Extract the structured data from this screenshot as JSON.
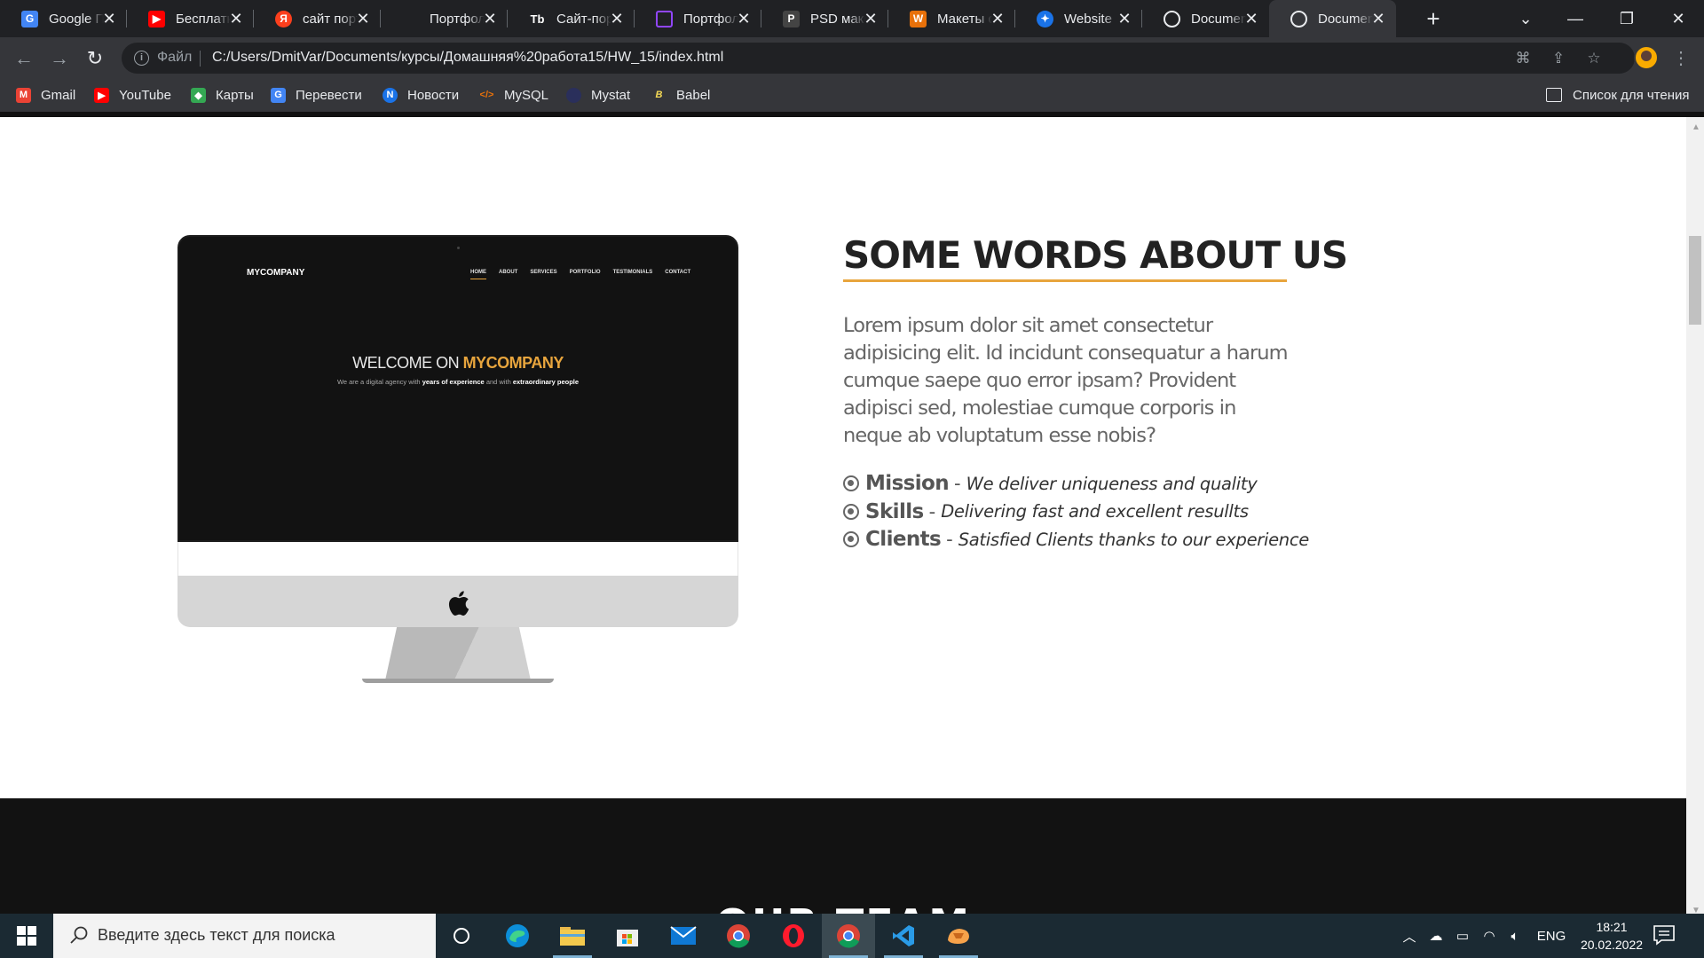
{
  "browser": {
    "tabs": [
      {
        "label": "Google П",
        "icon": "google-translate-icon",
        "color": "#4285f4"
      },
      {
        "label": "Бесплатн",
        "icon": "youtube-icon",
        "color": "#ff0000"
      },
      {
        "label": "сайт порт",
        "icon": "yandex-icon",
        "color": "#fc3f1d"
      },
      {
        "label": "Портфол",
        "icon": "blank-page-icon",
        "color": "#202124"
      },
      {
        "label": "Сайт-пор",
        "icon": "tilda-icon",
        "color": "#202124"
      },
      {
        "label": "Портфол",
        "icon": "twitch-icon",
        "color": "#9146ff"
      },
      {
        "label": "PSD маке",
        "icon": "psd-icon",
        "color": "#444444"
      },
      {
        "label": "Макеты с",
        "icon": "mockup-icon",
        "color": "#e8710a"
      },
      {
        "label": "Website",
        "icon": "website-icon",
        "color": "#1a73e8"
      },
      {
        "label": "Documen",
        "icon": "globe-icon",
        "color": "#9aa0a6"
      },
      {
        "label": "Documen",
        "icon": "globe-icon",
        "color": "#9aa0a6",
        "active": true
      }
    ],
    "address": {
      "file_label": "Файл",
      "url": "C:/Users/DmitVar/Documents/курсы/Домашняя%20работа15/HW_15/index.html"
    },
    "bookmarks": [
      {
        "label": "Gmail",
        "icon": "gmail-icon",
        "color": "#ea4335"
      },
      {
        "label": "YouTube",
        "icon": "youtube-icon",
        "color": "#ff0000"
      },
      {
        "label": "Карты",
        "icon": "maps-icon",
        "color": "#34a853"
      },
      {
        "label": "Перевести",
        "icon": "translate-icon",
        "color": "#4285f4"
      },
      {
        "label": "Новости",
        "icon": "news-icon",
        "color": "#1a73e8"
      },
      {
        "label": "MySQL",
        "icon": "code-icon",
        "color": "#e8710a"
      },
      {
        "label": "Mystat",
        "icon": "mystat-icon",
        "color": "#2a2f5b"
      },
      {
        "label": "Babel",
        "icon": "babel-icon",
        "color": "#f5da55"
      }
    ],
    "reading_list": "Список для чтения"
  },
  "page": {
    "mockup": {
      "logo": "MYCOMPANY",
      "nav": [
        "HOME",
        "ABOUT",
        "SERVICES",
        "PORTFOLIO",
        "TESTIMONIALS",
        "CONTACT"
      ],
      "hero_title_light": "WELCOME ON ",
      "hero_title_bold": "MYCOMPANY",
      "hero_sub_1": "We are a digital agency with ",
      "hero_sub_2": "years of experience",
      "hero_sub_3": " and with ",
      "hero_sub_4": "extraordinary people"
    },
    "about": {
      "title_light": "SOME WORDS ",
      "title_bold": "ABOUT US",
      "text": "Lorem ipsum dolor sit amet consectetur adipisicing elit. Id incidunt consequatur a harum cumque saepe quo error ipsam? Provident adipisci sed, molestiae cumque corporis in neque ab voluptatum esse nobis?",
      "features": [
        {
          "name": "Mission",
          "desc": "We deliver uniqueness and quality"
        },
        {
          "name": "Skills",
          "desc": "Delivering fast and excellent resullts"
        },
        {
          "name": "Clients",
          "desc": "Satisfied Clients thanks to our experience"
        }
      ],
      "accent_color": "#e8a53d"
    },
    "team_heading": "OUR TEAM"
  },
  "taskbar": {
    "search_placeholder": "Введите здесь текст для поиска",
    "language": "ENG",
    "time": "18:21",
    "date": "20.02.2022"
  }
}
